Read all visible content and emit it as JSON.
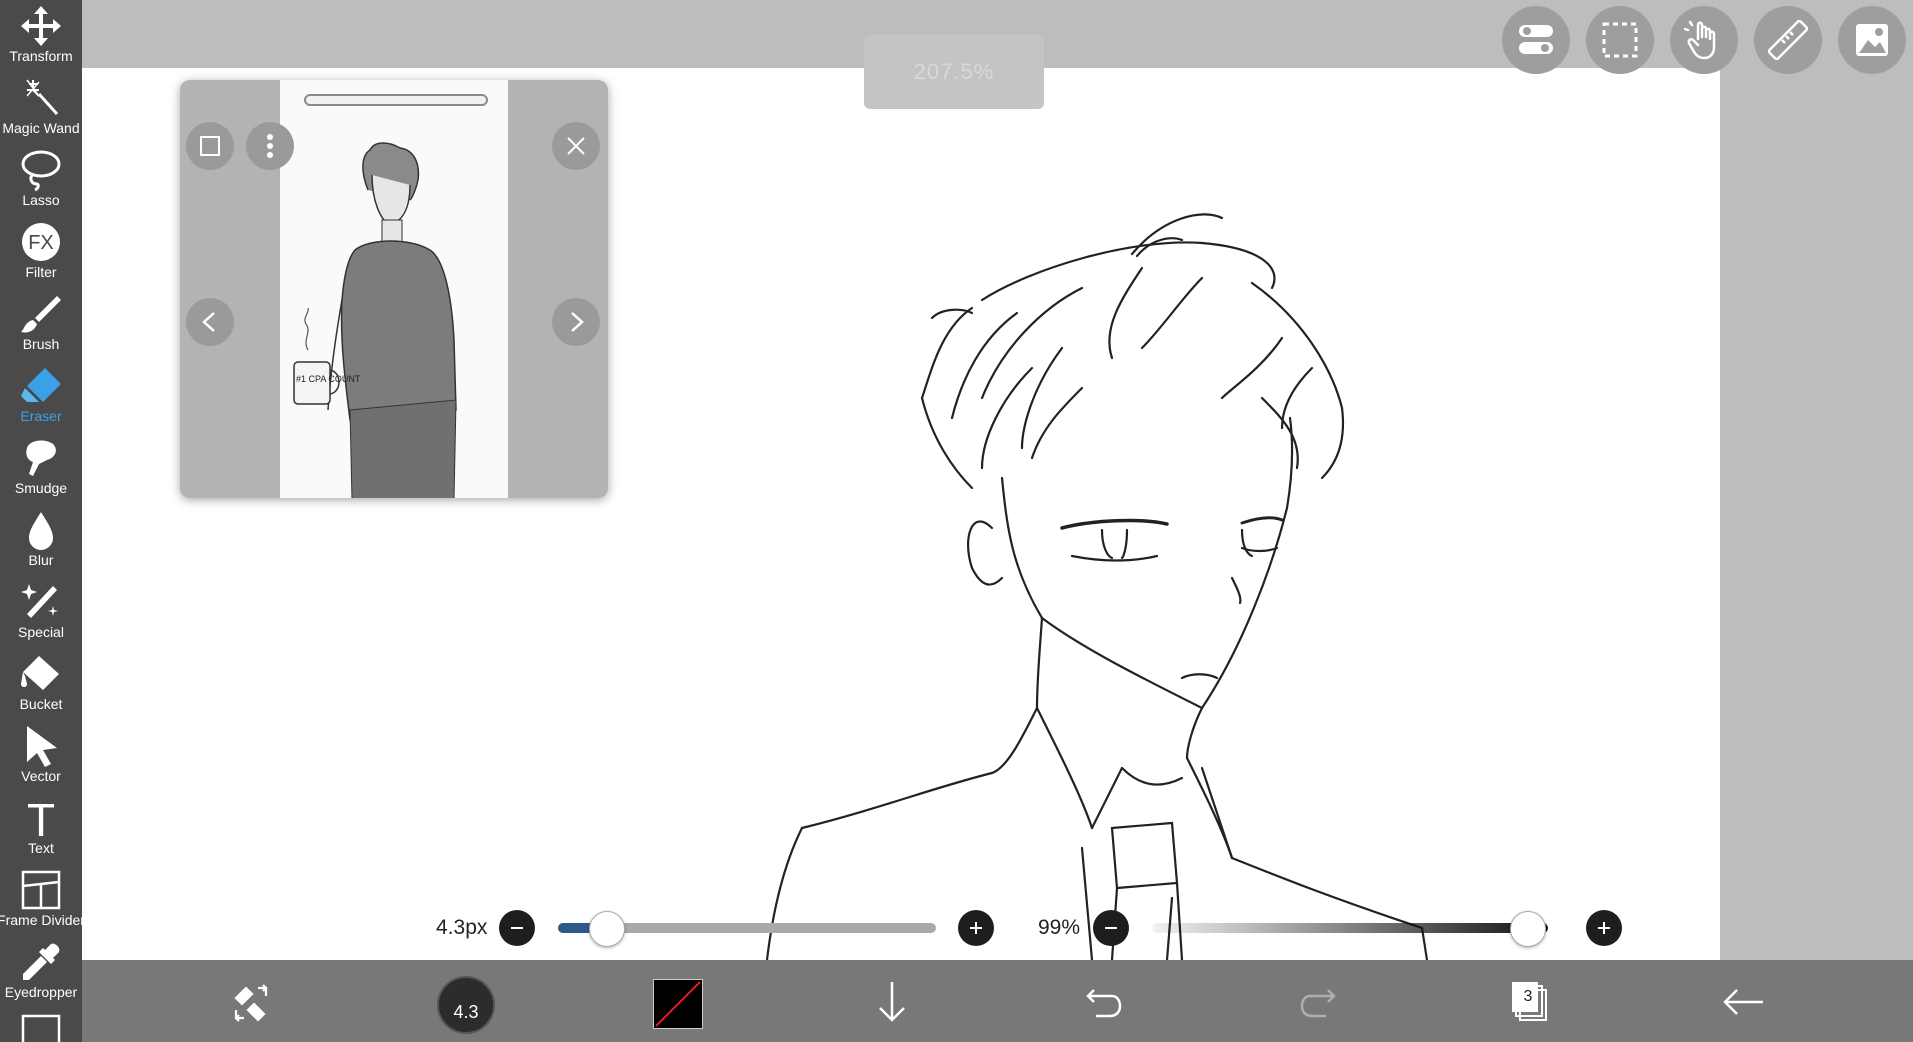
{
  "zoom": {
    "level": "207.5%"
  },
  "tools": [
    {
      "key": "transform",
      "label": "Transform"
    },
    {
      "key": "magic-wand",
      "label": "Magic Wand"
    },
    {
      "key": "lasso",
      "label": "Lasso"
    },
    {
      "key": "filter",
      "label": "Filter",
      "icon_text": "FX"
    },
    {
      "key": "brush",
      "label": "Brush"
    },
    {
      "key": "eraser",
      "label": "Eraser",
      "active": true
    },
    {
      "key": "smudge",
      "label": "Smudge"
    },
    {
      "key": "blur",
      "label": "Blur"
    },
    {
      "key": "special",
      "label": "Special"
    },
    {
      "key": "bucket",
      "label": "Bucket"
    },
    {
      "key": "vector",
      "label": "Vector"
    },
    {
      "key": "text",
      "label": "Text",
      "icon_text": "T"
    },
    {
      "key": "frame-divider",
      "label": "Frame Divider"
    },
    {
      "key": "eyedropper",
      "label": "Eyedropper"
    }
  ],
  "top_buttons": [
    "settings-toggle-icon",
    "selection-icon",
    "hand-icon",
    "ruler-icon",
    "material-icon"
  ],
  "reference_window": {
    "mug_text": "#1 CPA COUNT"
  },
  "brush_size": {
    "label": "4.3px",
    "value_fraction": 0.09
  },
  "opacity": {
    "label": "99%",
    "value_fraction": 0.99
  },
  "bottom": {
    "brush_preview_size": "4.3",
    "layers_count": "3"
  },
  "colors": {
    "sidebar": "#4a4a4a",
    "active_tool": "#3aa0e8",
    "bottom_bar": "#6e6e6e",
    "size_track_fill": "#2e5a8a"
  }
}
